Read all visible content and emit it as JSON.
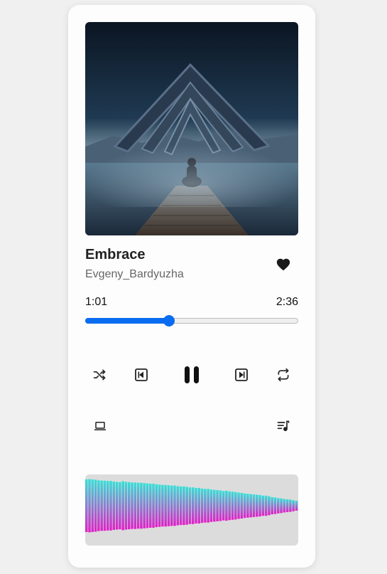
{
  "track": {
    "title": "Embrace",
    "artist": "Evgeny_Bardyuzha",
    "liked": true
  },
  "progress": {
    "current": "1:01",
    "duration": "2:36",
    "fraction": 0.39
  },
  "controls": {
    "shuffle_icon": "shuffle-icon",
    "previous_icon": "skip-previous-icon",
    "play_pause_icon": "pause-icon",
    "next_icon": "skip-next-icon",
    "repeat_icon": "repeat-icon",
    "device_icon": "laptop-icon",
    "queue_icon": "playlist-music-icon"
  },
  "visualizer": {
    "gradient_top": "#34e0d8",
    "gradient_bottom": "#e020c8",
    "levels": [
      0.86,
      0.87,
      0.86,
      0.85,
      0.83,
      0.82,
      0.82,
      0.81,
      0.81,
      0.79,
      0.78,
      0.77,
      0.8,
      0.78,
      0.77,
      0.76,
      0.76,
      0.75,
      0.75,
      0.74,
      0.73,
      0.72,
      0.72,
      0.7,
      0.69,
      0.68,
      0.68,
      0.67,
      0.66,
      0.66,
      0.64,
      0.63,
      0.63,
      0.62,
      0.6,
      0.6,
      0.58,
      0.58,
      0.56,
      0.55,
      0.55,
      0.53,
      0.52,
      0.51,
      0.5,
      0.48,
      0.49,
      0.47,
      0.46,
      0.45,
      0.43,
      0.42,
      0.4,
      0.39,
      0.38,
      0.37,
      0.36,
      0.35,
      0.33,
      0.33,
      0.31,
      0.28,
      0.27,
      0.25,
      0.24,
      0.22,
      0.21,
      0.2,
      0.18,
      0.16
    ]
  },
  "colors": {
    "accent": "#0a6cf0",
    "heart": "#1a1a1a"
  }
}
